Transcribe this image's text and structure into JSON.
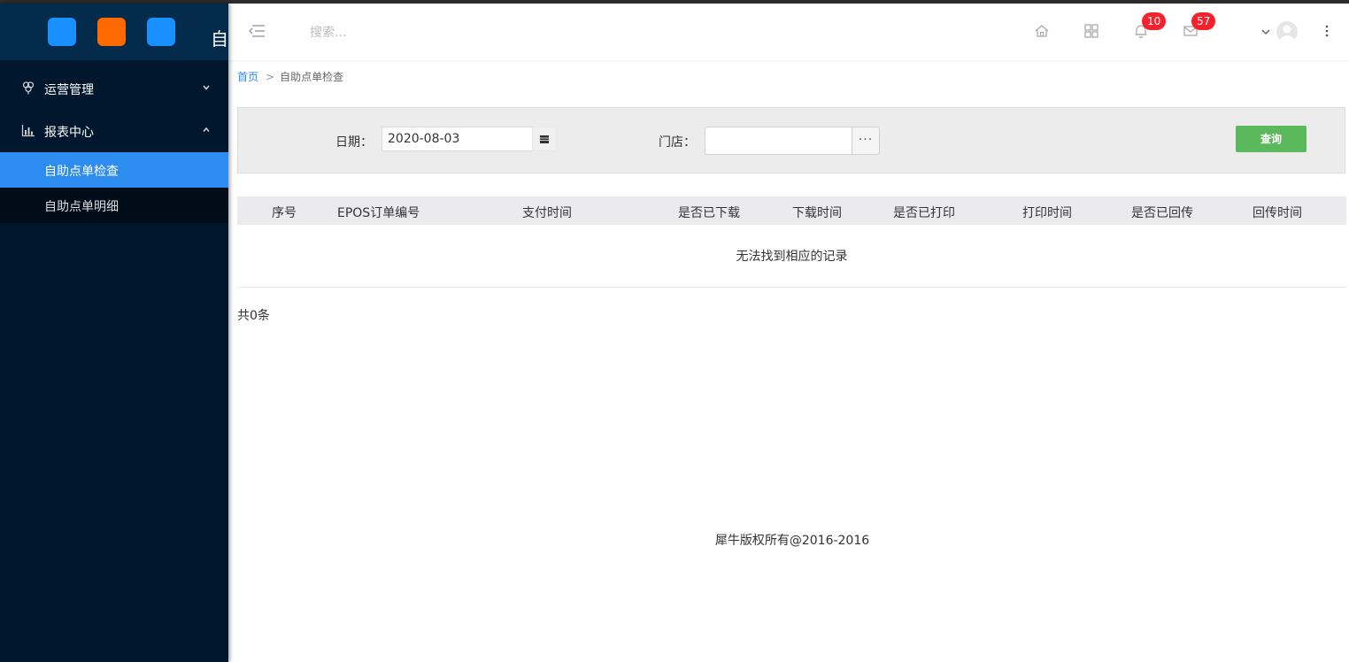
{
  "colors": {
    "sidebar_bg": "#00172e",
    "brand_bg": "#042a4c",
    "active_item_bg": "#2d8cf0",
    "query_button_bg": "#5cb85c",
    "badge_bg": "#f5222d",
    "filter_bg": "#ececec"
  },
  "brand": {
    "text": "自"
  },
  "sidebar": {
    "groups": [
      {
        "label": "运营管理",
        "icon": "flower-icon",
        "expanded": false
      },
      {
        "label": "报表中心",
        "icon": "bar-chart-icon",
        "expanded": true,
        "items": [
          {
            "label": "自助点单检查",
            "active": true
          },
          {
            "label": "自助点单明细",
            "active": false
          }
        ]
      }
    ]
  },
  "header": {
    "search_placeholder": "搜索...",
    "notifications_count": "10",
    "messages_count": "57"
  },
  "breadcrumb": {
    "home": "首页",
    "separator": ">",
    "current": "自助点单检查"
  },
  "filter": {
    "date_label": "日期：",
    "date_value": "2020-08-03",
    "store_label": "门店：",
    "store_value": "",
    "more_label": "···",
    "query_label": "查询"
  },
  "table": {
    "columns": [
      "序号",
      "EPOS订单编号",
      "支付时间",
      "是否已下载",
      "下载时间",
      "是否已打印",
      "打印时间",
      "是否已回传",
      "回传时间"
    ],
    "empty_text": "无法找到相应的记录",
    "total_text": "共0条"
  },
  "footer": {
    "text": "犀牛版权所有@2016-2016"
  }
}
